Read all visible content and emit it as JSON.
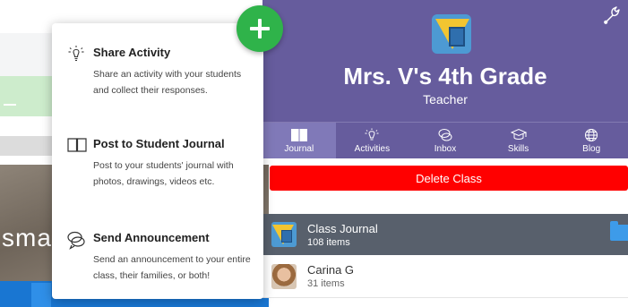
{
  "popup": {
    "items": [
      {
        "title": "Share Activity",
        "desc": "Share an activity with your students and collect their responses.",
        "icon": "lightbulb-icon"
      },
      {
        "title": "Post to Student Journal",
        "desc": "Post to your students' journal with photos, drawings, videos etc.",
        "icon": "book-icon"
      },
      {
        "title": "Send Announcement",
        "desc": "Send an announcement to your entire class, their families, or both!",
        "icon": "speech-bubbles-icon"
      }
    ]
  },
  "background": {
    "partial_text": "smal"
  },
  "header": {
    "title": "Mrs. V's 4th Grade",
    "subtitle": "Teacher"
  },
  "nav": {
    "tabs": [
      {
        "label": "Journal",
        "icon": "book-icon"
      },
      {
        "label": "Activities",
        "icon": "lightbulb-icon"
      },
      {
        "label": "Inbox",
        "icon": "chat-icon"
      },
      {
        "label": "Skills",
        "icon": "graduation-cap-icon"
      },
      {
        "label": "Blog",
        "icon": "globe-icon"
      }
    ]
  },
  "delete_label": "Delete Class",
  "list": [
    {
      "name": "Class Journal",
      "count": "108 items"
    },
    {
      "name": "Carina G",
      "count": "31 items"
    }
  ],
  "colors": {
    "header": "#665c9d",
    "fab": "#2fb34a",
    "delete": "#ff0000",
    "journal_row": "#58606c"
  }
}
